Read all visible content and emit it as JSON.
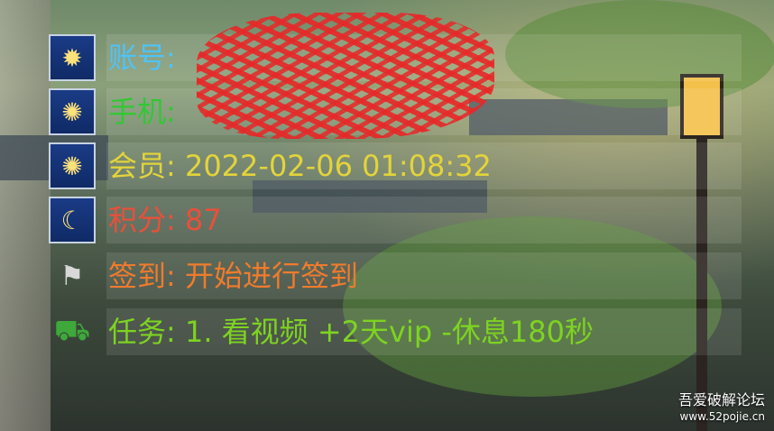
{
  "rows": [
    {
      "icon": "fireworks-icon",
      "text": "账号: ",
      "color": "#4fc3f7"
    },
    {
      "icon": "sparkler-icon",
      "text": "手机: ",
      "color": "#31c833"
    },
    {
      "icon": "sparkler-icon",
      "text": "会员: 2022-02-06 01:08:32",
      "color": "#e3d43a"
    },
    {
      "icon": "moon-viewing-icon",
      "text": "积分: 87",
      "color": "#e8503a"
    },
    {
      "icon": "bus-stop-icon",
      "text": "签到: 开始进行签到",
      "color": "#f07b2d"
    },
    {
      "icon": "tractor-icon",
      "text": "任务: 1. 看视频 +2天vip -休息180秒",
      "color": "#7ed321"
    }
  ],
  "watermark": {
    "line1": "吾爱破解论坛",
    "line2": "www.52pojie.cn"
  }
}
